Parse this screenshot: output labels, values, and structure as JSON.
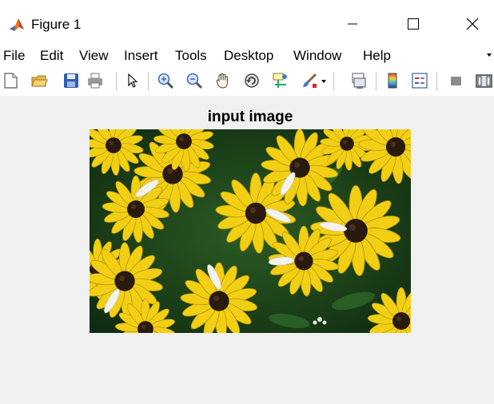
{
  "window": {
    "title": "Figure 1",
    "app_icon": "matlab-icon",
    "controls": [
      "minimize-icon",
      "maximize-icon",
      "close-icon"
    ]
  },
  "menubar": {
    "items": [
      "File",
      "Edit",
      "View",
      "Insert",
      "Tools",
      "Desktop",
      "Window",
      "Help"
    ]
  },
  "toolbar": {
    "icons": [
      "new-figure-icon",
      "open-file-icon",
      "save-icon",
      "print-icon",
      "select-arrow-icon",
      "zoom-in-icon",
      "zoom-out-icon",
      "pan-hand-icon",
      "rotate-3d-icon",
      "data-cursor-icon",
      "brush-icon",
      "brush-dropdown-icon",
      "link-plot-icon",
      "colorbar-icon",
      "legend-icon",
      "hide-plot-tools-icon",
      "show-plot-tools-icon"
    ]
  },
  "axes": {
    "title": "input image",
    "image": "black-eyed-susan-flowers-photo"
  },
  "colors": {
    "background": "#f0f0f0",
    "chrome": "#ffffff",
    "petal": "#f2d21a",
    "foliage": "#1f4a1c",
    "center": "#2a1a0e"
  }
}
